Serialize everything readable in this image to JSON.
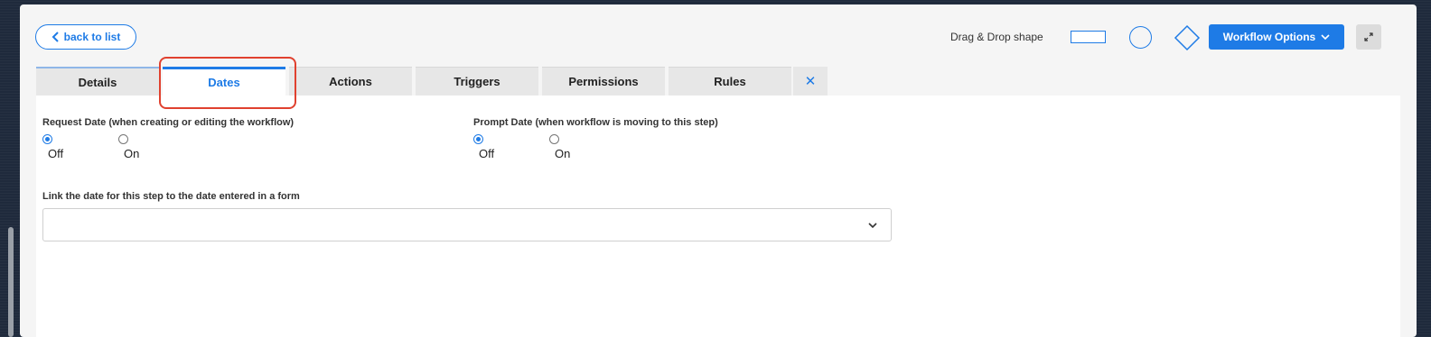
{
  "toolbar": {
    "back_label": "back to list",
    "shape_label": "Drag & Drop shape",
    "workflow_options_label": "Workflow Options"
  },
  "tabs": [
    {
      "label": "Details"
    },
    {
      "label": "Dates",
      "active": true
    },
    {
      "label": "Actions"
    },
    {
      "label": "Triggers"
    },
    {
      "label": "Permissions"
    },
    {
      "label": "Rules"
    }
  ],
  "close_symbol": "✕",
  "dates": {
    "request": {
      "label": "Request Date (when creating or editing the workflow)",
      "options": [
        "Off",
        "On"
      ],
      "selected": "Off"
    },
    "prompt": {
      "label": "Prompt Date (when workflow is moving to this step)",
      "options": [
        "Off",
        "On"
      ],
      "selected": "Off"
    },
    "link": {
      "label": "Link the date for this step to the date entered in a form",
      "value": ""
    }
  },
  "colors": {
    "accent": "#1e7be6",
    "highlight": "#e0412f"
  },
  "icons": [
    "chevron-left-icon",
    "rectangle-shape-icon",
    "circle-shape-icon",
    "diamond-shape-icon",
    "chevron-down-icon",
    "expand-icon",
    "close-icon"
  ]
}
